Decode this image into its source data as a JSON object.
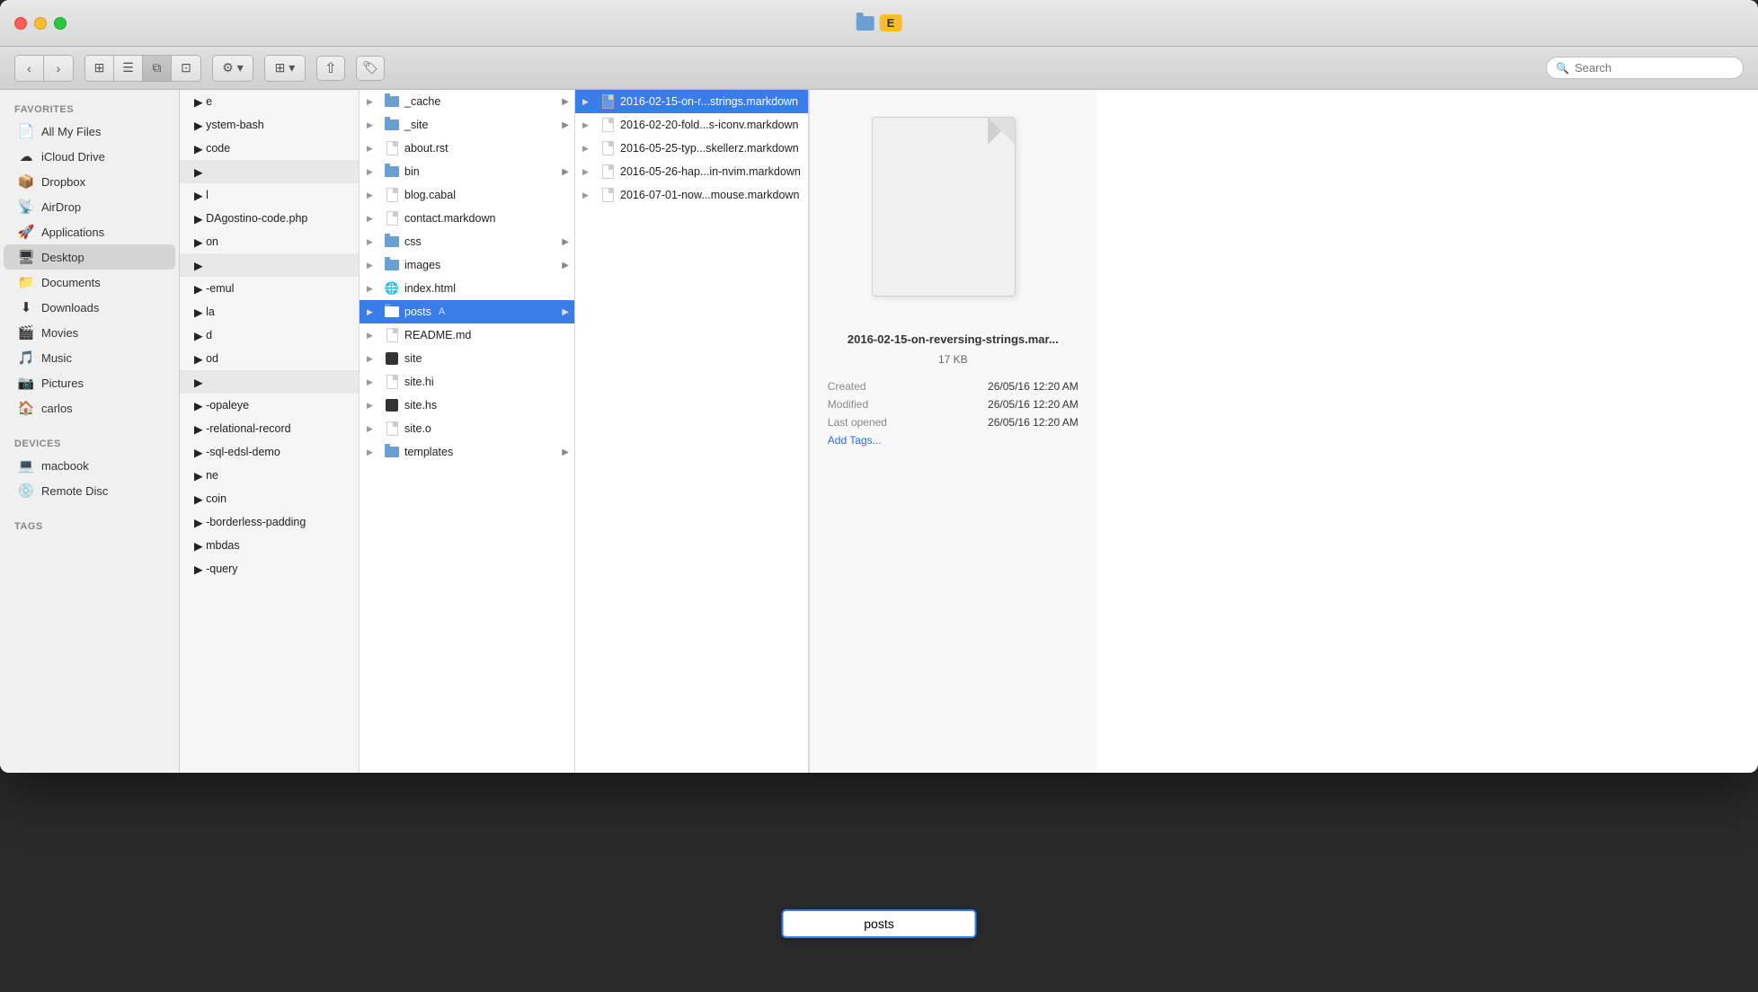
{
  "window": {
    "title": "E",
    "title_bg": "#febc2e"
  },
  "toolbar": {
    "back_label": "‹",
    "forward_label": "›",
    "view_icon_label": "⊞",
    "list_icon_label": "≡",
    "column_icon_label": "⊟",
    "gallery_icon_label": "⊡",
    "gear_label": "⚙",
    "arrange_label": "⊞",
    "share_label": "↑",
    "tag_label": "○",
    "search_placeholder": "Search"
  },
  "sidebar": {
    "favorites_header": "Favorites",
    "devices_header": "Devices",
    "tags_header": "Tags",
    "items": [
      {
        "label": "All My Files",
        "icon": "📄"
      },
      {
        "label": "iCloud Drive",
        "icon": "☁"
      },
      {
        "label": "Dropbox",
        "icon": "📦"
      },
      {
        "label": "AirDrop",
        "icon": "📡"
      },
      {
        "label": "Applications",
        "icon": "🚀"
      },
      {
        "label": "Desktop",
        "icon": "🖥",
        "active": true
      },
      {
        "label": "Documents",
        "icon": "📁"
      },
      {
        "label": "Downloads",
        "icon": "⬇"
      },
      {
        "label": "Movies",
        "icon": "🎬"
      },
      {
        "label": "Music",
        "icon": "🎵"
      },
      {
        "label": "Pictures",
        "icon": "📷"
      },
      {
        "label": "carlos",
        "icon": "🏠"
      }
    ],
    "devices": [
      {
        "label": "macbook",
        "icon": "💻"
      },
      {
        "label": "Remote Disc",
        "icon": "💿"
      }
    ]
  },
  "column1_partial": [
    {
      "label": "e",
      "type": "text"
    },
    {
      "label": "ystem-bash",
      "type": "text"
    },
    {
      "label": "code",
      "type": "text"
    },
    {
      "label": "",
      "type": "folder",
      "empty": true
    },
    {
      "label": "l",
      "type": "text"
    },
    {
      "label": "DAgostino-code.php",
      "type": "text"
    },
    {
      "label": "on",
      "type": "text"
    },
    {
      "label": "",
      "type": "folder",
      "empty": true
    },
    {
      "label": "-emul",
      "type": "text"
    },
    {
      "label": "la",
      "type": "text"
    },
    {
      "label": "d",
      "type": "text"
    },
    {
      "label": "od",
      "type": "text"
    },
    {
      "label": "",
      "type": "folder",
      "empty": true
    },
    {
      "label": "-opaleye",
      "type": "text"
    },
    {
      "label": "-relational-record",
      "type": "text"
    },
    {
      "label": "-sql-edsl-demo",
      "type": "text"
    },
    {
      "label": "ne",
      "type": "text"
    },
    {
      "label": "coin",
      "type": "text"
    },
    {
      "label": "-borderless-padding",
      "type": "text"
    },
    {
      "label": "mbdas",
      "type": "text"
    },
    {
      "label": "-query",
      "type": "text",
      "partial": true
    }
  ],
  "column2": [
    {
      "label": "_cache",
      "type": "folder",
      "has_arrow": true
    },
    {
      "label": "_site",
      "type": "folder",
      "has_arrow": true
    },
    {
      "label": "about.rst",
      "type": "file"
    },
    {
      "label": "bin",
      "type": "folder",
      "has_arrow": true
    },
    {
      "label": "blog.cabal",
      "type": "file"
    },
    {
      "label": "contact.markdown",
      "type": "file"
    },
    {
      "label": "css",
      "type": "folder",
      "has_arrow": true
    },
    {
      "label": "images",
      "type": "folder",
      "has_arrow": true
    },
    {
      "label": "index.html",
      "type": "file",
      "icon": "chrome"
    },
    {
      "label": "posts",
      "type": "folder",
      "selected": true,
      "has_arrow": true
    },
    {
      "label": "README.md",
      "type": "file"
    },
    {
      "label": "site",
      "type": "file",
      "icon": "black"
    },
    {
      "label": "site.hi",
      "type": "file"
    },
    {
      "label": "site.hs",
      "type": "file",
      "icon": "black"
    },
    {
      "label": "site.o",
      "type": "file"
    },
    {
      "label": "templates",
      "type": "folder",
      "has_arrow": true
    }
  ],
  "column3": [
    {
      "label": "2016-02-15-on-r...strings.markdown",
      "type": "file",
      "selected": true
    },
    {
      "label": "2016-02-20-fold...s-iconv.markdown",
      "type": "file"
    },
    {
      "label": "2016-05-25-typ...skellerz.markdown",
      "type": "file"
    },
    {
      "label": "2016-05-26-hap...in-nvim.markdown",
      "type": "file"
    },
    {
      "label": "2016-07-01-now...mouse.markdown",
      "type": "file"
    }
  ],
  "preview": {
    "filename": "2016-02-15-on-reversing-strings.mar...",
    "filesize": "17 KB",
    "created_label": "Created",
    "created_value": "26/05/16 12:20 AM",
    "modified_label": "Modified",
    "modified_value": "26/05/16 12:20 AM",
    "last_opened_label": "Last opened",
    "last_opened_value": "26/05/16 12:20 AM",
    "add_tags": "Add Tags..."
  },
  "rename_bar": {
    "value": "posts"
  }
}
